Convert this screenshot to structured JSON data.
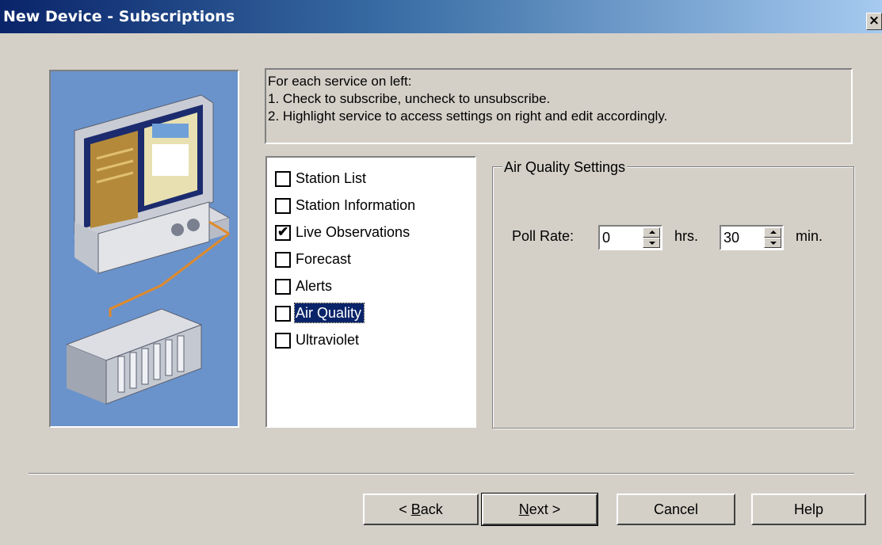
{
  "window": {
    "title": "New Device - Subscriptions",
    "close_glyph": "×"
  },
  "instructions": {
    "line1": "For each service on left:",
    "line2": "1. Check to subscribe, uncheck to unsubscribe.",
    "line3": "2. Highlight service to access settings on right and edit accordingly."
  },
  "services": [
    {
      "label": "Station List",
      "checked": false,
      "selected": false
    },
    {
      "label": "Station Information",
      "checked": false,
      "selected": false
    },
    {
      "label": "Live Observations",
      "checked": true,
      "selected": false
    },
    {
      "label": "Forecast",
      "checked": false,
      "selected": false
    },
    {
      "label": "Alerts",
      "checked": false,
      "selected": false
    },
    {
      "label": "Air Quality",
      "checked": false,
      "selected": true
    },
    {
      "label": "Ultraviolet",
      "checked": false,
      "selected": false
    }
  ],
  "settings": {
    "group_title": "Air Quality Settings",
    "poll_rate_label": "Poll Rate:",
    "hours_value": "0",
    "hours_unit": "hrs.",
    "minutes_value": "30",
    "minutes_unit": "min."
  },
  "buttons": {
    "back_prefix": "< ",
    "back_mnemonic": "B",
    "back_rest": "ack",
    "next_mnemonic": "N",
    "next_rest": "ext >",
    "cancel": "Cancel",
    "help": "Help"
  },
  "colors": {
    "face": "#d4d0c8",
    "title_start": "#0a246a",
    "title_end": "#a6caf0",
    "selection": "#0a246a",
    "picture_bg": "#6a93cc"
  },
  "icons": {
    "checkmark": "✔",
    "picture": "computer-plc-illustration"
  }
}
